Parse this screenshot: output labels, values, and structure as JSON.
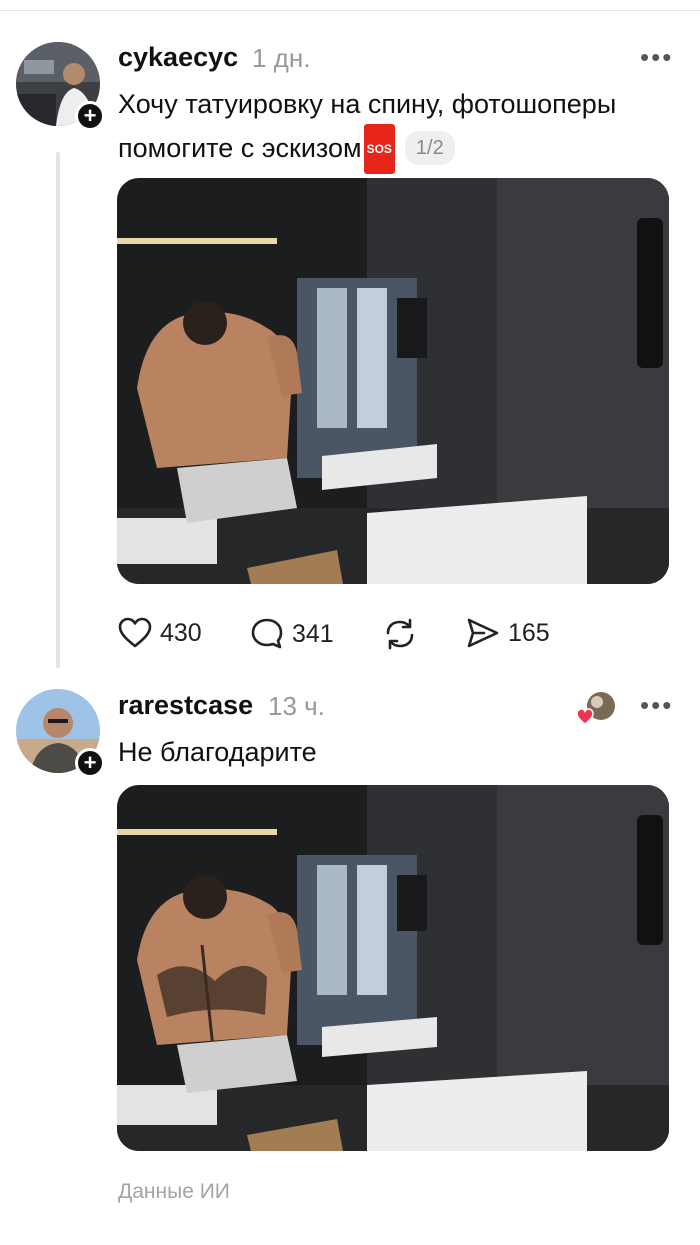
{
  "post": {
    "username": "cykaecyc",
    "time": "1 дн.",
    "text": "Хочу татуировку на спину, фотошоперы помогите с эскизом",
    "sos": "SOS",
    "page_indicator": "1/2",
    "likes": "430",
    "comments": "341",
    "shares": "165"
  },
  "reply": {
    "username": "rarestcase",
    "time": "13 ч.",
    "text": "Не благодарите"
  },
  "footer": {
    "ai_label": "Данные ИИ"
  },
  "icons": [
    "plus-icon",
    "more-icon",
    "heart-icon",
    "comment-icon",
    "repost-icon",
    "share-icon"
  ]
}
